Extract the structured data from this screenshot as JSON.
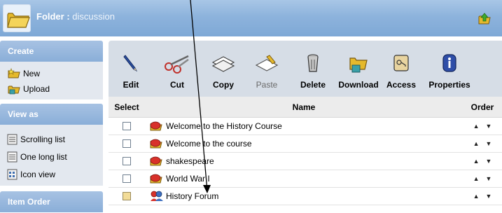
{
  "header": {
    "title_label": "Folder :",
    "title_value": " discussion",
    "folder_icon": "folder-icon",
    "up_icon": "folder-up-icon"
  },
  "sidebar": {
    "sections": [
      {
        "title": "Create",
        "items": [
          {
            "label": "New",
            "icon": "new-folder-icon"
          },
          {
            "label": "Upload",
            "icon": "upload-icon"
          }
        ]
      },
      {
        "title": "View as",
        "items": [
          {
            "label": "Scrolling list",
            "icon": "list-icon"
          },
          {
            "label": "One long list",
            "icon": "list-icon"
          },
          {
            "label": "Icon view",
            "icon": "icon-view-icon"
          }
        ]
      },
      {
        "title": "Item Order",
        "items": []
      }
    ]
  },
  "toolbar": {
    "edit": "Edit",
    "cut": "Cut",
    "copy": "Copy",
    "paste": "Paste",
    "delete": "Delete",
    "download": "Download",
    "access": "Access",
    "properties": "Properties"
  },
  "table": {
    "headers": {
      "select": "Select",
      "name": "Name",
      "order": "Order"
    },
    "rows": [
      {
        "name": "Welcome to the History Course",
        "icon": "discussion-icon",
        "highlight": false
      },
      {
        "name": "Welcome to the course",
        "icon": "discussion-icon",
        "highlight": false
      },
      {
        "name": "shakespeare",
        "icon": "discussion-icon",
        "highlight": false
      },
      {
        "name": "World War I",
        "icon": "discussion-icon",
        "highlight": false
      },
      {
        "name": "History Forum",
        "icon": "forum-icon",
        "highlight": true
      }
    ],
    "order_up": "▲",
    "order_down": "▼"
  },
  "colors": {
    "header_blue": "#8db3dc",
    "sidebar_head": "#8aaed8",
    "sidebar_bg": "#e3e8ef",
    "toolbar_bg": "#d6dde6",
    "checkbox_highlight": "#f2dc98"
  }
}
